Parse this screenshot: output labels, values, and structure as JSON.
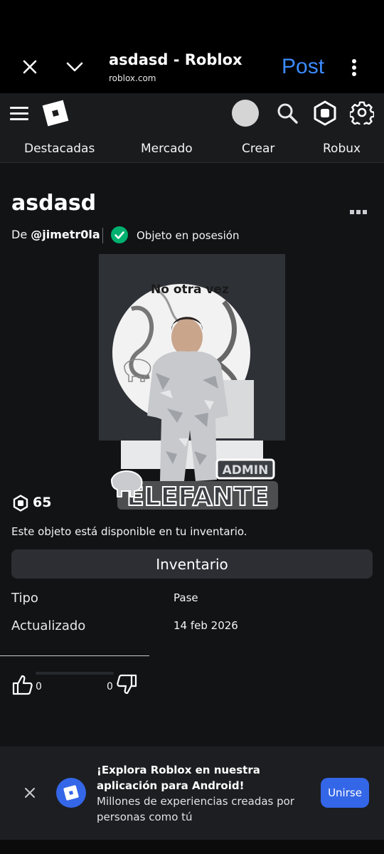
{
  "browser": {
    "title": "asdasd - Roblox",
    "url": "roblox.com",
    "post_label": "Post",
    "accent": "#3b8bff"
  },
  "header": {
    "nav_tabs": [
      "Destacadas",
      "Mercado",
      "Crear",
      "Robux"
    ]
  },
  "item": {
    "name": "asdasd",
    "by_prefix": "De",
    "creator": "@jimetr0la",
    "owned_text": "Objeto en posesión",
    "price": "65",
    "availability": "Este objeto está disponible en tu inventario.",
    "inventory_button": "Inventario",
    "details": [
      {
        "label": "Tipo",
        "value": "Pase"
      },
      {
        "label": "Actualizado",
        "value": "14 feb 2026"
      }
    ],
    "thumbnail_text": {
      "top": "No otra vez",
      "bottom_small": "ADMIN",
      "bottom_big": "ELEFANTE"
    },
    "votes": {
      "up": "0",
      "down": "0"
    }
  },
  "banner": {
    "title": "¡Explora Roblox en nuestra aplicación para Android!",
    "subtitle": "Millones de experiencias creadas por personas como tú",
    "button": "Unirse"
  },
  "colors": {
    "background": "#121315",
    "owned_check": "#00b06f",
    "banner_blue": "#3466e8"
  }
}
